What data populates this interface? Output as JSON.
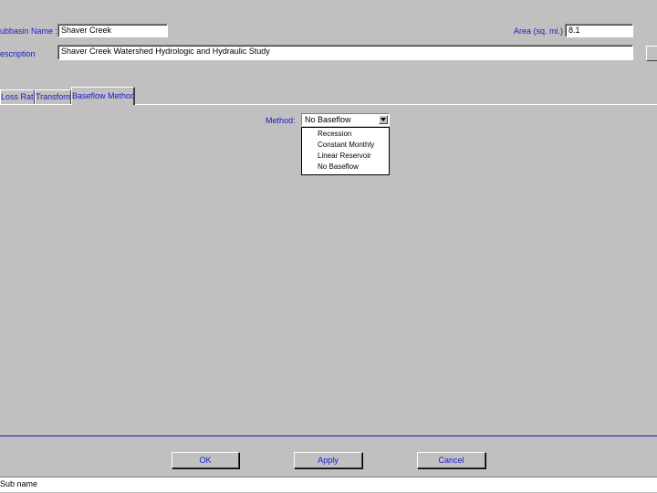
{
  "form": {
    "subbasin_label": "ubbasin Name :",
    "subbasin_value": "Shaver Creek",
    "area_label": "Area (sq. mi.)",
    "area_value": "8.1",
    "description_label": "escription",
    "description_value": "Shaver Creek Watershed Hydrologic and Hydraulic Study"
  },
  "tabs": [
    {
      "label": "Loss Rate",
      "active": false
    },
    {
      "label": "Transform",
      "active": false
    },
    {
      "label": "Baseflow Method",
      "active": true
    }
  ],
  "baseflow": {
    "method_label": "Method:",
    "selected": "No Baseflow",
    "options": [
      "Recession",
      "Constant Monthly",
      "Linear Reservoir",
      "No Baseflow"
    ]
  },
  "buttons": {
    "ok": "OK",
    "apply": "Apply",
    "cancel": "Cancel"
  },
  "status": {
    "text": "Sub name"
  },
  "colors": {
    "window_bg": "#c0c0c0",
    "label_text": "#1a1acc",
    "field_bg": "#ffffff"
  }
}
